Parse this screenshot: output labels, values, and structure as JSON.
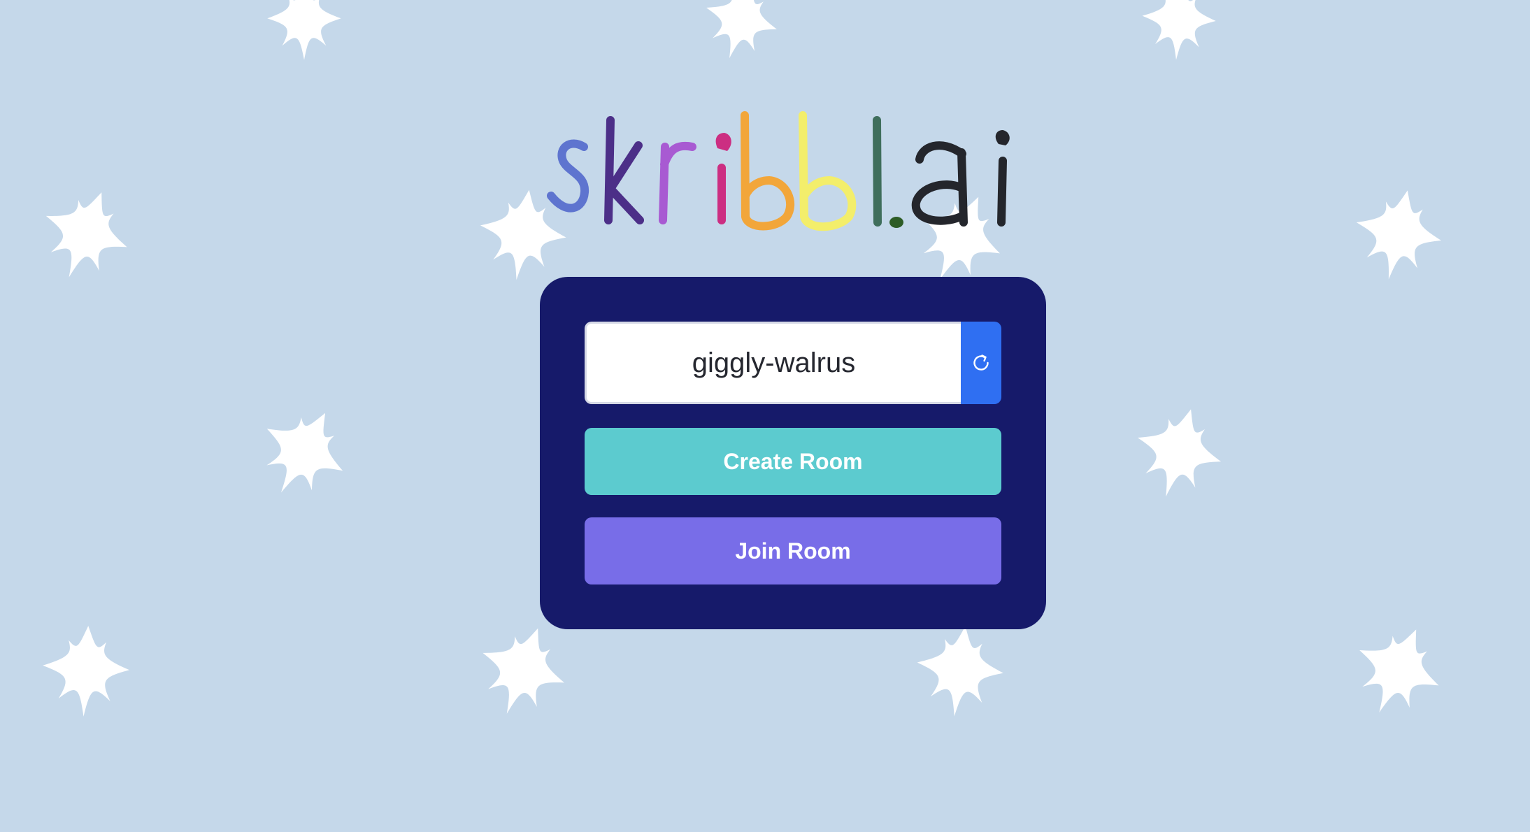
{
  "logo": {
    "text": "skribbl.ai",
    "letter_colors": [
      "#5e74cf",
      "#4c2f88",
      "#a85ad2",
      "#cc2e82",
      "#f2a63a",
      "#f3ee6b",
      "#3f6e5c",
      "#2d5c26",
      "#24262c"
    ]
  },
  "form": {
    "username_value": "giggly-walrus",
    "refresh_icon": "refresh-icon",
    "create_label": "Create Room",
    "join_label": "Join Room"
  },
  "colors": {
    "background": "#c5d8ea",
    "panel": "#161a6a",
    "refresh_button": "#2f6ff2",
    "create_button": "#5ccbcf",
    "join_button": "#786de8",
    "star": "#ffffff"
  }
}
